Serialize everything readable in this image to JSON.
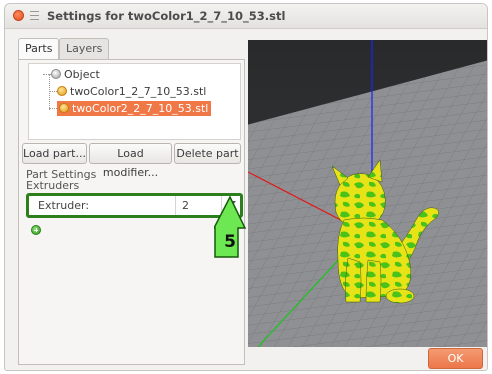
{
  "window": {
    "title": "Settings for twoColor1_2_7_10_53.stl"
  },
  "tabs": [
    {
      "label": "Parts",
      "active": true
    },
    {
      "label": "Layers",
      "active": false
    }
  ],
  "tree": {
    "root": {
      "label": "Object",
      "icon": "object-icon"
    },
    "children": [
      {
        "label": "twoColor1_2_7_10_53.stl",
        "icon": "part-icon",
        "selected": false
      },
      {
        "label": "twoColor2_2_7_10_53.stl",
        "icon": "part-icon",
        "selected": true
      }
    ]
  },
  "buttons": {
    "load_part": "Load part...",
    "load_modifier": "Load modifier...",
    "delete_part": "Delete part",
    "ok": "OK"
  },
  "settings": {
    "section_label": "Part Settings",
    "group_label": "Extruders",
    "extruder": {
      "name": "Extruder:",
      "value": "2"
    }
  },
  "annotation": {
    "number": "5",
    "color": "#1e8a10"
  },
  "colors": {
    "accent": "#f07746",
    "highlight_green": "#2d7f1c",
    "cat_yellow": "#e8e317",
    "cat_green": "#49c21a"
  }
}
